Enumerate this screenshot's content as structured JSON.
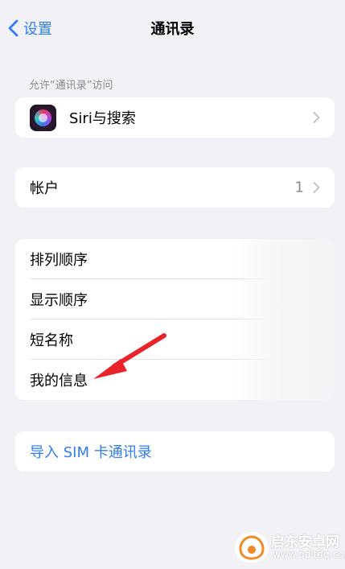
{
  "nav": {
    "back_label": "设置",
    "title": "通讯录"
  },
  "access_section": {
    "header": "允许“通讯录”访问",
    "siri_label": "Siri与搜索"
  },
  "accounts": {
    "label": "帐户",
    "value": "1"
  },
  "settings": {
    "sort_order": "排列顺序",
    "display_order": "显示顺序",
    "short_name": "短名称",
    "my_info": "我的信息"
  },
  "import": {
    "label": "导入 SIM 卡通讯录"
  },
  "watermark": {
    "name": "启东安卓网",
    "url": "www.qdltdq.com"
  },
  "colors": {
    "accent": "#2f7cf6",
    "background": "#f2f2f6",
    "annotation_arrow": "#e8232a"
  },
  "icons": {
    "back": "chevron-left-icon",
    "siri": "siri-icon",
    "disclosure": "chevron-right-icon",
    "annotation": "red-arrow-icon"
  }
}
